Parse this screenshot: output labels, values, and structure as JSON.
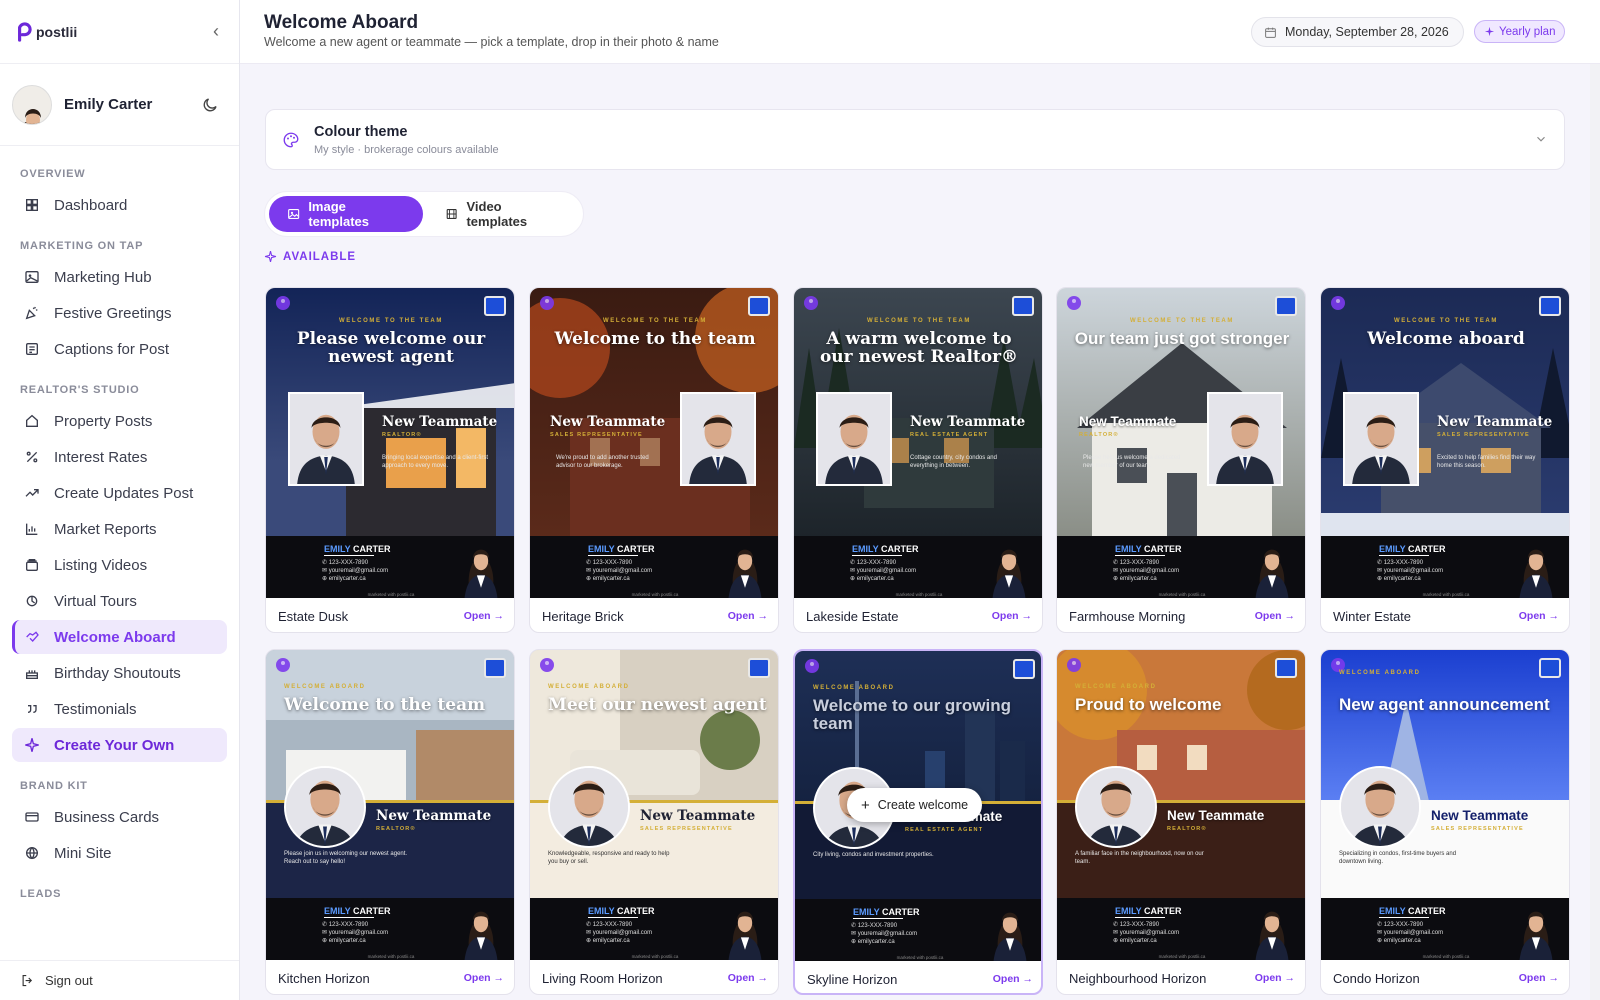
{
  "app": {
    "brand": "postlii"
  },
  "user": {
    "name": "Emily Carter"
  },
  "nav": {
    "sections": [
      {
        "title": "OVERVIEW",
        "items": [
          {
            "label": "Dashboard",
            "icon": "dashboard-icon"
          }
        ]
      },
      {
        "title": "MARKETING ON TAP",
        "items": [
          {
            "label": "Marketing Hub",
            "icon": "image-icon"
          },
          {
            "label": "Festive Greetings",
            "icon": "party-icon"
          },
          {
            "label": "Captions for Post",
            "icon": "caption-icon"
          }
        ]
      },
      {
        "title": "REALTOR'S STUDIO",
        "items": [
          {
            "label": "Property Posts",
            "icon": "home-icon"
          },
          {
            "label": "Interest Rates",
            "icon": "percent-icon"
          },
          {
            "label": "Create Updates Post",
            "icon": "trend-icon"
          },
          {
            "label": "Market Reports",
            "icon": "bar-chart-icon"
          },
          {
            "label": "Listing Videos",
            "icon": "video-icon"
          },
          {
            "label": "Virtual Tours",
            "icon": "tour-icon"
          },
          {
            "label": "Welcome Aboard",
            "icon": "handshake-icon",
            "active": true
          },
          {
            "label": "Birthday Shoutouts",
            "icon": "cake-icon"
          },
          {
            "label": "Testimonials",
            "icon": "quote-icon"
          },
          {
            "label": "Create Your Own",
            "icon": "sparkle-icon",
            "highlight": true
          }
        ]
      },
      {
        "title": "BRAND KIT",
        "items": [
          {
            "label": "Business Cards",
            "icon": "card-icon"
          },
          {
            "label": "Mini Site",
            "icon": "globe-icon"
          }
        ]
      },
      {
        "title": "LEADS",
        "items": []
      }
    ],
    "sign_out": "Sign out"
  },
  "header": {
    "title": "Welcome Aboard",
    "subtitle": "Welcome a new agent or teammate — pick a template, drop in their photo & name",
    "date": "Monday, September 28, 2026",
    "plan": "Yearly plan"
  },
  "theme": {
    "title": "Colour theme",
    "subtitle": "My style · brokerage colours available"
  },
  "tabs": [
    {
      "label": "Image templates",
      "icon": "image-icon",
      "active": true
    },
    {
      "label": "Video templates",
      "icon": "film-icon",
      "active": false
    }
  ],
  "available_label": "AVAILABLE",
  "create_button": "Create welcome",
  "open_label": "Open →",
  "colors": {
    "accent": "#7c3aed",
    "accent_soft": "#efe9fc"
  },
  "template_text": {
    "agent_first": "EMILY",
    "agent_last": "CARTER",
    "phone": "123-XXX-7890",
    "email": "youremail@gmail.com",
    "web": "emilycarter.ca",
    "marketed": "marketed with postlii.ca",
    "new_teammate": "New Teammate"
  },
  "templates": [
    {
      "name": "Estate Dusk",
      "kicker": "WELCOME TO THE TEAM",
      "headline": "Please welcome our newest agent",
      "role": "REALTOR®",
      "blurb": "Bringing local expertise and a client-first approach to every move."
    },
    {
      "name": "Heritage Brick",
      "kicker": "WELCOME TO THE TEAM",
      "headline": "Welcome to the team",
      "role": "SALES REPRESENTATIVE",
      "blurb": "We're proud to add another trusted advisor to our brokerage."
    },
    {
      "name": "Lakeside Estate",
      "kicker": "WELCOME TO THE TEAM",
      "headline": "A warm welcome to our newest Realtor®",
      "role": "REAL ESTATE AGENT",
      "blurb": "Cottage country, city condos and everything in between."
    },
    {
      "name": "Farmhouse Morning",
      "kicker": "WELCOME TO THE TEAM",
      "headline": "Our team just got stronger",
      "role": "REALTOR®",
      "blurb": "Please help us welcome a dedicated new member of our team."
    },
    {
      "name": "Winter Estate",
      "kicker": "WELCOME TO THE TEAM",
      "headline": "Welcome aboard",
      "role": "SALES REPRESENTATIVE",
      "blurb": "Excited to help families find their way home this season."
    },
    {
      "name": "Kitchen Horizon",
      "kicker": "WELCOME ABOARD",
      "headline": "Welcome to the team",
      "role": "REALTOR®",
      "blurb": "Please join us in welcoming our newest agent. Reach out to say hello!"
    },
    {
      "name": "Living Room Horizon",
      "kicker": "WELCOME ABOARD",
      "headline": "Meet our newest agent",
      "role": "SALES REPRESENTATIVE",
      "blurb": "Knowledgeable, responsive and ready to help you buy or sell."
    },
    {
      "name": "Skyline Horizon",
      "kicker": "WELCOME ABOARD",
      "headline": "Welcome to our growing team",
      "role": "REAL ESTATE AGENT",
      "blurb": "City living, condos and investment properties."
    },
    {
      "name": "Neighbourhood Horizon",
      "kicker": "WELCOME ABOARD",
      "headline": "Proud to welcome",
      "role": "REALTOR®",
      "blurb": "A familiar face in the neighbourhood, now on our team."
    },
    {
      "name": "Condo Horizon",
      "kicker": "WELCOME ABOARD",
      "headline": "New agent announcement",
      "role": "SALES REPRESENTATIVE",
      "blurb": "Specializing in condos, first-time buyers and downtown living."
    }
  ]
}
